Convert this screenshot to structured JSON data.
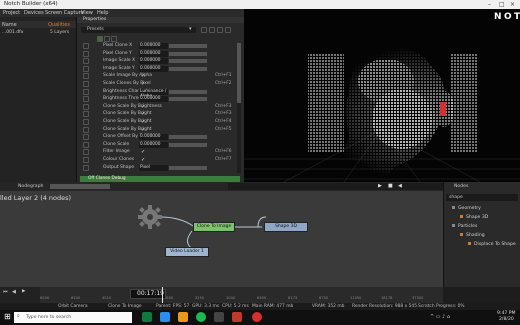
{
  "window": {
    "title": "Notch Builder (x64)"
  },
  "menu": [
    "Project",
    "Devices",
    "Screen Capture",
    "View",
    "Help"
  ],
  "project": {
    "header": "Name",
    "header_right": "Qualities",
    "file": "...001.dfx",
    "layers": "5 Layers"
  },
  "properties": {
    "tab": "Properties",
    "presets_label": "Presets",
    "rows": [
      {
        "label": "Pixel Clone X",
        "value": "0.000000",
        "key": ""
      },
      {
        "label": "Pixel Clone Y",
        "value": "0.000000",
        "key": ""
      },
      {
        "label": "Image Scale X",
        "value": "0.000000",
        "key": ""
      },
      {
        "label": "Image Scale Y",
        "value": "0.000000",
        "key": ""
      },
      {
        "label": "Scale Image By Alpha",
        "check": true,
        "key": "Ctrl+F1"
      },
      {
        "label": "Scale Clones By Pixel",
        "check": true,
        "key": "Ctrl+F2"
      },
      {
        "label": "Brightness Channel",
        "value": "Luminance / Alpha",
        "key": ""
      },
      {
        "label": "Brightness Threshold",
        "value": "0.000000",
        "key": ""
      },
      {
        "label": "Clone Scale By Brightness",
        "check": true,
        "key": "Ctrl+F3"
      },
      {
        "label": "Clone Scale By Bright",
        "check": true,
        "key": "Ctrl+F3"
      },
      {
        "label": "Clone Scale By Bright",
        "check": true,
        "key": "Ctrl+F4"
      },
      {
        "label": "Clone Scale By Bright",
        "check": true,
        "key": "Ctrl+F5"
      },
      {
        "label": "Clone Offset By Bright",
        "value": "0.000000",
        "key": ""
      },
      {
        "label": "Clone Scale",
        "value": "0.000000",
        "key": ""
      },
      {
        "label": "Filter Image",
        "check": true,
        "key": "Ctrl+F6"
      },
      {
        "label": "Colour Clones",
        "check": true,
        "key": "Ctrl+F7"
      },
      {
        "label": "Output Shape",
        "value": "Pixel",
        "key": ""
      }
    ],
    "footer": "Off Clones Debug"
  },
  "nodegraph": {
    "tab": "Nodegraph",
    "layer_title": "lled Layer 2 (4 nodes)",
    "nodes": {
      "clone": "Clone To Image",
      "shape": "Shape 3D",
      "video": "Video Loader 1"
    }
  },
  "right_panel": {
    "tab": "Nodes",
    "search": "shape",
    "tree": [
      {
        "label": "Geometry",
        "indent": 0
      },
      {
        "label": "Shape 3D",
        "indent": 1
      },
      {
        "label": "Particles",
        "indent": 0
      },
      {
        "label": "Shading",
        "indent": 1
      },
      {
        "label": "Displace To Shape",
        "indent": 2
      }
    ]
  },
  "timeline": {
    "timecode": "00:17:19",
    "ruler": [
      "6200",
      "8100",
      "4010",
      "8150",
      "6600",
      "3250",
      "1000",
      "6350",
      "8173",
      "6750",
      "11050",
      "18178",
      "37500"
    ]
  },
  "status": {
    "items": [
      "Orbit Camera",
      "Clone To Image",
      "Parent: FPS: 57",
      "GPU: 3.3 ms",
      "CPU: 5.2 ms",
      "Main RAM: 477 mb",
      "VRAM: 352 mb",
      "Render Resolution: 988 x 545",
      "Scratch Progress: 0%"
    ]
  },
  "taskbar": {
    "search_placeholder": "Type here to search",
    "time": "9:47 PM",
    "date": "2/8/20"
  },
  "colors": {
    "node_green": "#7dc26a",
    "node_blue": "#8fa6c7",
    "node_video": "#9eb4cf",
    "wire": "#b8c9d8",
    "accent_green": "#4fae4a"
  }
}
